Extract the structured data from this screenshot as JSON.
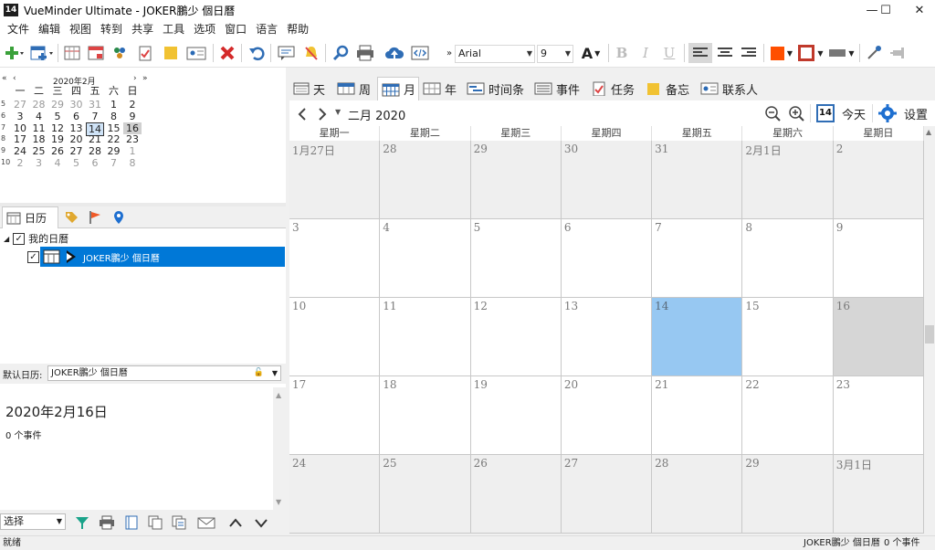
{
  "window": {
    "icon_text": "14",
    "title": "VueMinder Ultimate - JOKER鵬少 個日曆",
    "minimize": "—",
    "maximize": "☐",
    "close": "✕"
  },
  "menu": [
    "文件",
    "编辑",
    "视图",
    "转到",
    "共享",
    "工具",
    "选项",
    "窗口",
    "语言",
    "帮助"
  ],
  "toolbar": {
    "font_name": "Arial",
    "font_size": "9",
    "bold": "B",
    "italic": "I",
    "underline": "U",
    "grow_font": "A",
    "fill_color": "#ff4f00",
    "border_color": "#c0392b"
  },
  "mini_calendar": {
    "title": "2020年2月",
    "nav_prev2": "«",
    "nav_prev": "‹",
    "nav_next": "›",
    "nav_next2": "»",
    "dow": [
      "一",
      "二",
      "三",
      "四",
      "五",
      "六",
      "日"
    ],
    "weeks": [
      {
        "wk": "5",
        "days": [
          {
            "d": "27",
            "o": true
          },
          {
            "d": "28",
            "o": true
          },
          {
            "d": "29",
            "o": true
          },
          {
            "d": "30",
            "o": true
          },
          {
            "d": "31",
            "o": true
          },
          {
            "d": "1"
          },
          {
            "d": "2"
          }
        ]
      },
      {
        "wk": "6",
        "days": [
          {
            "d": "3"
          },
          {
            "d": "4"
          },
          {
            "d": "5"
          },
          {
            "d": "6"
          },
          {
            "d": "7"
          },
          {
            "d": "8"
          },
          {
            "d": "9"
          }
        ]
      },
      {
        "wk": "7",
        "days": [
          {
            "d": "10"
          },
          {
            "d": "11"
          },
          {
            "d": "12"
          },
          {
            "d": "13"
          },
          {
            "d": "14",
            "t": true
          },
          {
            "d": "15"
          },
          {
            "d": "16",
            "s": true
          }
        ]
      },
      {
        "wk": "8",
        "days": [
          {
            "d": "17"
          },
          {
            "d": "18"
          },
          {
            "d": "19"
          },
          {
            "d": "20"
          },
          {
            "d": "21"
          },
          {
            "d": "22"
          },
          {
            "d": "23"
          }
        ]
      },
      {
        "wk": "9",
        "days": [
          {
            "d": "24"
          },
          {
            "d": "25"
          },
          {
            "d": "26"
          },
          {
            "d": "27"
          },
          {
            "d": "28"
          },
          {
            "d": "29"
          },
          {
            "d": "1",
            "o": true
          }
        ]
      },
      {
        "wk": "10",
        "days": [
          {
            "d": "2",
            "o": true
          },
          {
            "d": "3",
            "o": true
          },
          {
            "d": "4",
            "o": true
          },
          {
            "d": "5",
            "o": true
          },
          {
            "d": "6",
            "o": true
          },
          {
            "d": "7",
            "o": true
          },
          {
            "d": "8",
            "o": true
          }
        ]
      }
    ]
  },
  "calendars_panel": {
    "tab_label": "日历",
    "root_label": "我的日曆",
    "root_checked": "✓",
    "item_label": "JOKER鵬少 個日曆",
    "item_checked": "✓"
  },
  "default_calendar": {
    "label": "默认日历:",
    "value": "JOKER鵬少 個日曆"
  },
  "day_detail": {
    "date": "2020年2月16日",
    "count": "0 个事件"
  },
  "left_bottom": {
    "select_label": "选择"
  },
  "view_tabs": [
    {
      "label": "天"
    },
    {
      "label": "周"
    },
    {
      "label": "月"
    },
    {
      "label": "年"
    },
    {
      "label": "时间条"
    },
    {
      "label": "事件"
    },
    {
      "label": "任务"
    },
    {
      "label": "备忘"
    },
    {
      "label": "联系人"
    }
  ],
  "nav": {
    "month_title": "二月 2020",
    "today_icon": "14",
    "today_label": "今天",
    "settings_label": "设置"
  },
  "month_grid": {
    "dow": [
      "星期一",
      "星期二",
      "星期三",
      "星期四",
      "星期五",
      "星期六",
      "星期日"
    ],
    "weeks": [
      [
        "1月27日",
        "28",
        "29",
        "30",
        "31",
        "2月1日",
        "2"
      ],
      [
        "3",
        "4",
        "5",
        "6",
        "7",
        "8",
        "9"
      ],
      [
        "10",
        "11",
        "12",
        "13",
        "14",
        "15",
        "16"
      ],
      [
        "17",
        "18",
        "19",
        "20",
        "21",
        "22",
        "23"
      ],
      [
        "24",
        "25",
        "26",
        "27",
        "28",
        "29",
        "3月1日"
      ]
    ]
  },
  "status": {
    "left": "就绪",
    "calendar": "JOKER鵬少 個日曆",
    "count": "0 个事件"
  }
}
